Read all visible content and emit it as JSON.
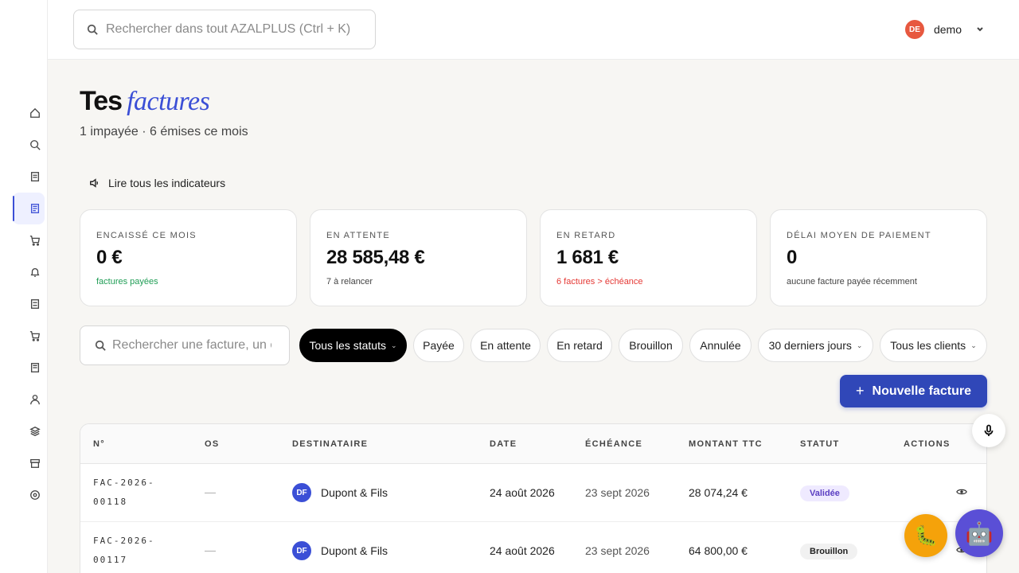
{
  "search": {
    "placeholder": "Rechercher dans tout AZALPLUS (Ctrl + K)"
  },
  "user": {
    "initials": "DE",
    "name": "demo"
  },
  "sidebar": {
    "items": [
      {
        "icon": "home-icon"
      },
      {
        "icon": "search-icon"
      },
      {
        "icon": "document-icon"
      },
      {
        "icon": "invoice-icon",
        "active": true
      },
      {
        "icon": "cart-icon"
      },
      {
        "icon": "bell-icon"
      },
      {
        "icon": "file-icon"
      },
      {
        "icon": "cart-icon"
      },
      {
        "icon": "receipt-icon"
      },
      {
        "icon": "user-icon"
      },
      {
        "icon": "layers-icon"
      },
      {
        "icon": "archive-icon"
      },
      {
        "icon": "settings-icon"
      }
    ]
  },
  "header": {
    "title": "Tes",
    "title_accent": "factures",
    "subtitle": "1 impayée · 6 émises ce mois",
    "read_indicators": "Lire tous les indicateurs"
  },
  "kpis": [
    {
      "label": "ENCAISSÉ CE MOIS",
      "value": "0 €",
      "note": "factures payées"
    },
    {
      "label": "EN ATTENTE",
      "value": "28 585,48 €",
      "note": "7 à relancer"
    },
    {
      "label": "EN RETARD",
      "value": "1 681 €",
      "note": "6 factures > échéance"
    },
    {
      "label": "DÉLAI MOYEN DE PAIEMENT",
      "value": "0",
      "note": "aucune facture payée récemment"
    }
  ],
  "filters": {
    "search_placeholder": "Rechercher une facture, un client",
    "chips": [
      "Tous les statuts",
      "Payée",
      "En attente",
      "En retard",
      "Brouillon",
      "Annulée",
      "30 derniers jours",
      "Tous les clients"
    ]
  },
  "new_invoice": "Nouvelle facture",
  "table": {
    "headers": [
      "N°",
      "OS",
      "DESTINATAIRE",
      "DATE",
      "ÉCHÉANCE",
      "MONTANT TTC",
      "STATUT",
      "ACTIONS"
    ],
    "rows": [
      {
        "num": "FAC-2026-00118",
        "os": "—",
        "initials": "DF",
        "client": "Dupont & Fils",
        "date": "24 août 2026",
        "due": "23 sept 2026",
        "amount": "28 074,24 €",
        "status": "Validée"
      },
      {
        "num": "FAC-2026-00117",
        "os": "—",
        "initials": "DF",
        "client": "Dupont & Fils",
        "date": "24 août 2026",
        "due": "23 sept 2026",
        "amount": "64 800,00 €",
        "status": "Brouillon"
      }
    ]
  },
  "colors": {
    "accent": "#3b4fd6",
    "primary_button": "#3047b8",
    "danger": "#e53935",
    "success": "#1f9d55"
  }
}
